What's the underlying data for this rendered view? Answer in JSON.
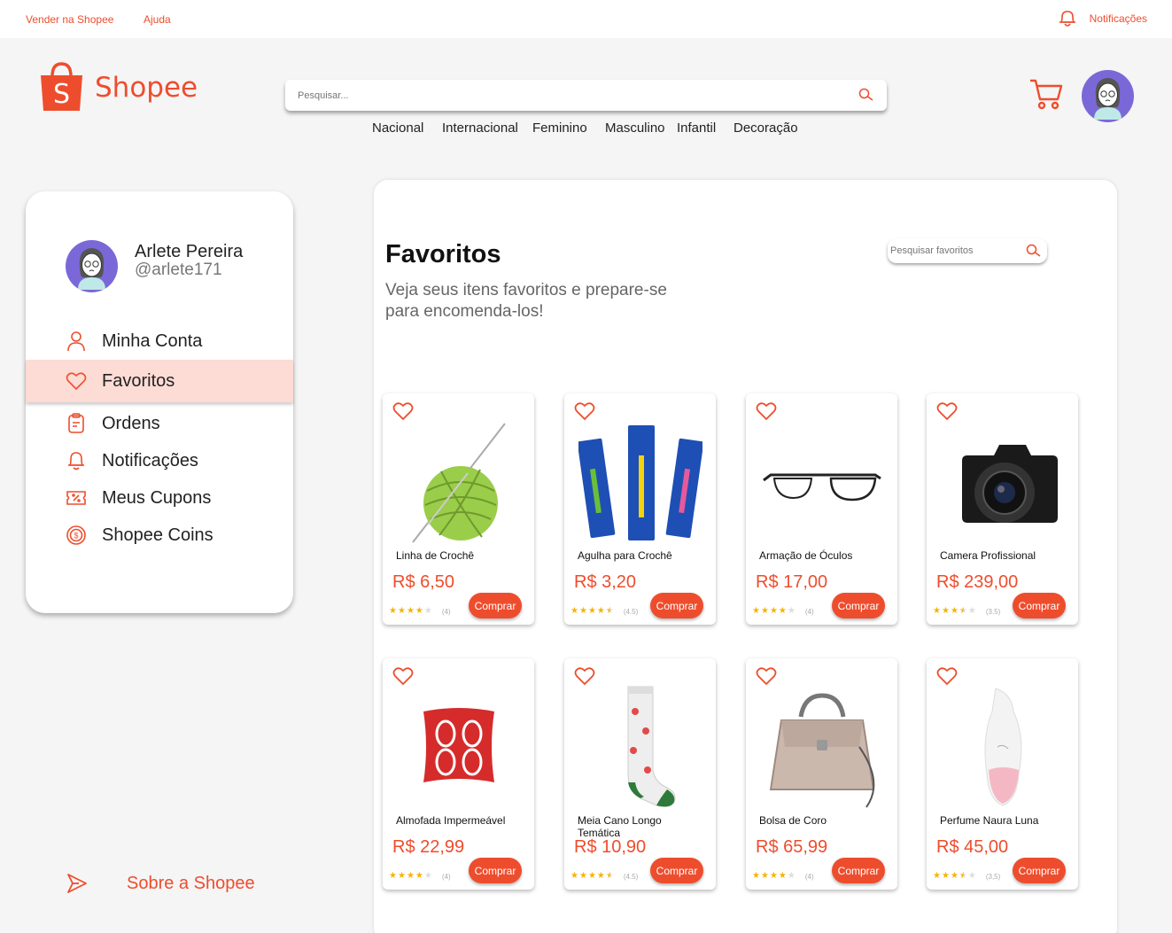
{
  "topbar": {
    "sell_label": "Vender na Shopee",
    "help_label": "Ajuda",
    "notifications_label": "Notificações"
  },
  "header": {
    "logo_text": "Shopee",
    "search_placeholder": "Pesquisar...",
    "categories": [
      "Nacional",
      "Internacional",
      "Feminino",
      "Masculino",
      "Infantil",
      "Decoração"
    ]
  },
  "profile": {
    "name": "Arlete Pereira",
    "handle": "@arlete171"
  },
  "sidebar": {
    "items": [
      {
        "label": "Minha Conta",
        "icon": "user-icon"
      },
      {
        "label": "Favoritos",
        "icon": "heart-icon",
        "active": true
      },
      {
        "label": "Ordens",
        "icon": "clipboard-icon"
      },
      {
        "label": "Notificações",
        "icon": "bell-icon"
      },
      {
        "label": "Meus Cupons",
        "icon": "coupon-icon"
      },
      {
        "label": "Shopee Coins",
        "icon": "coin-icon"
      }
    ],
    "about_label": "Sobre a Shopee"
  },
  "main": {
    "title": "Favoritos",
    "subtitle": "Veja seus itens favoritos e prepare-se para encomenda-los!",
    "search_placeholder": "Pesquisar favoritos"
  },
  "buy_label": "Comprar",
  "products": [
    {
      "name": "Linha de Crochê",
      "price": "R$ 6,50",
      "rating": 4,
      "rating_text": "(4)",
      "image": "yarn-ball"
    },
    {
      "name": "Agulha para Crochê",
      "price": "R$ 3,20",
      "rating": 4.5,
      "rating_text": "(4.5)",
      "image": "crochet-hooks"
    },
    {
      "name": "Armação de Óculos",
      "price": "R$ 17,00",
      "rating": 4,
      "rating_text": "(4)",
      "image": "glasses"
    },
    {
      "name": "Camera Profissional",
      "price": "R$ 239,00",
      "rating": 3.5,
      "rating_text": "(3.5)",
      "image": "camera"
    },
    {
      "name": "Almofada Impermeável",
      "price": "R$ 22,99",
      "rating": 4,
      "rating_text": "(4)",
      "image": "pillow"
    },
    {
      "name": "Meia Cano Longo Temática",
      "price": "R$ 10,90",
      "rating": 4.5,
      "rating_text": "(4.5)",
      "image": "sock"
    },
    {
      "name": "Bolsa de Coro",
      "price": "R$ 65,99",
      "rating": 4,
      "rating_text": "(4)",
      "image": "handbag"
    },
    {
      "name": "Perfume Naura Luna",
      "price": "R$ 45,00",
      "rating": 3.5,
      "rating_text": "(3,5)",
      "image": "perfume"
    }
  ],
  "colors": {
    "brand": "#ee4d2d",
    "active_bg": "#fcdcd5",
    "star": "#f5b301",
    "avatar_bg": "#7b68d8"
  }
}
